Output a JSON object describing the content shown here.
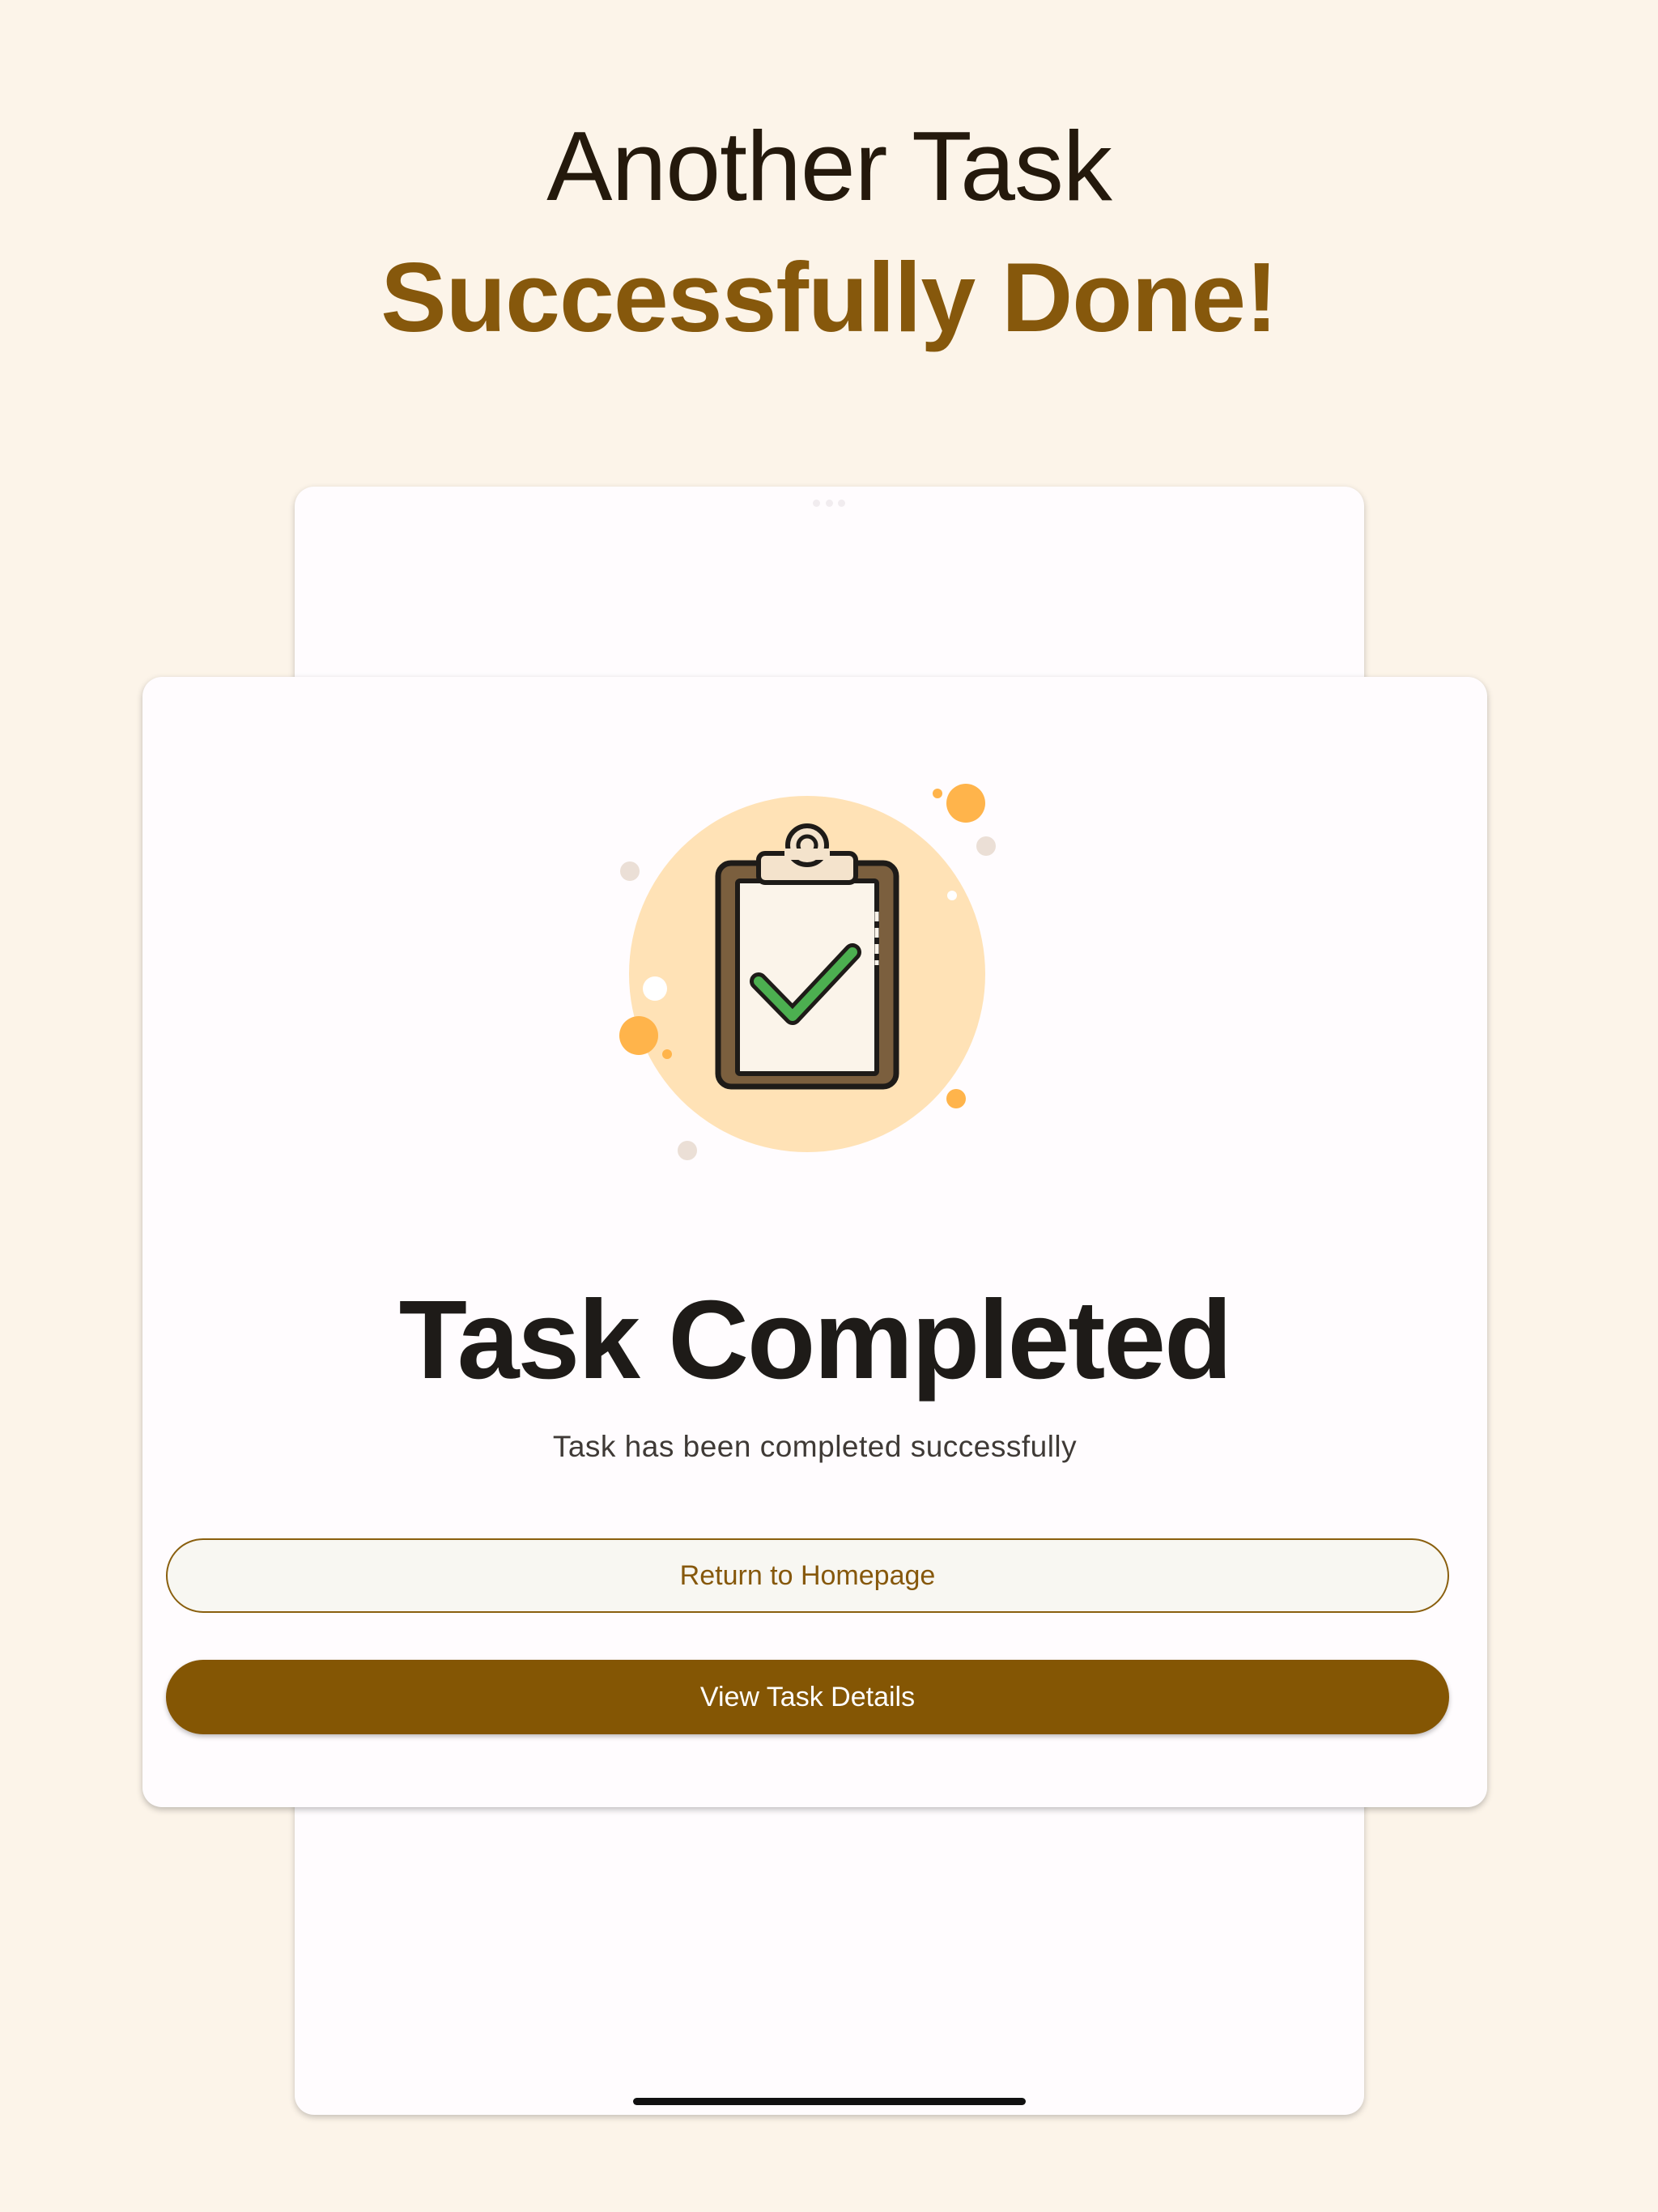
{
  "headline": {
    "line1": "Another Task",
    "line2": "Successfully Done!"
  },
  "card": {
    "title": "Task Completed",
    "subtitle": "Task has been completed successfully",
    "illustration_icon": "clipboard-check-icon"
  },
  "buttons": {
    "return_label": "Return to Homepage",
    "details_label": "View Task Details"
  },
  "colors": {
    "background": "#fcf4e9",
    "accent_brown": "#845604",
    "check_green": "#4caf50",
    "circle_peach": "#ffe2b6",
    "dot_orange": "#ffb44b"
  }
}
